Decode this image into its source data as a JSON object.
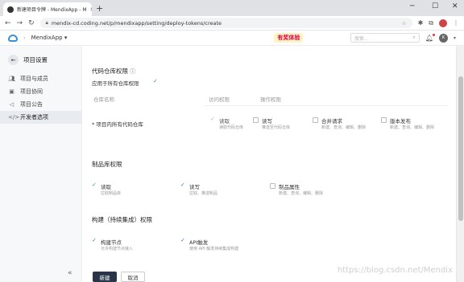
{
  "browser": {
    "tab_title": "新建项目令牌 - MendixApp - M",
    "url": "mendix-cd.coding.net/p/mendixapp/setting/deploy-tokens/create"
  },
  "header": {
    "project": "MendixApp",
    "promo": "有奖体验",
    "search_placeholder": "搜索...",
    "avatar_initial": "K"
  },
  "sidebar": {
    "back_label": "项目设置",
    "items": [
      {
        "label": "项目与成员",
        "icon": "members-icon",
        "active": false
      },
      {
        "label": "项目协同",
        "icon": "collab-icon",
        "active": false
      },
      {
        "label": "项目公告",
        "icon": "announce-icon",
        "active": false
      },
      {
        "label": "开发者选项",
        "icon": "code-icon",
        "active": true
      }
    ]
  },
  "repo": {
    "title": "代码仓库权限",
    "apply_all": "应用于所有仓库权限",
    "col_name": "仓库名称",
    "col_access": "访问权限",
    "col_ops": "操作权限",
    "row_name": "* 项目内所有代码仓库",
    "perms": [
      {
        "label": "读取",
        "hint": "读取代码仓库",
        "checked": true,
        "disabled": true
      },
      {
        "label": "读写",
        "hint": "推送至代码仓库",
        "checked": false
      },
      {
        "label": "合并请求",
        "hint": "新建、查询、编辑、删除",
        "checked": false
      },
      {
        "label": "版本发布",
        "hint": "新建、查询、编辑、删除",
        "checked": false
      }
    ]
  },
  "artifact": {
    "title": "制品库权限",
    "perms": [
      {
        "label": "读取",
        "hint": "拉取制品库",
        "checked": true
      },
      {
        "label": "读写",
        "hint": "拉取、推送制品",
        "checked": true
      },
      {
        "label": "制品属性",
        "hint": "新建、查询、编辑、删除",
        "checked": false
      }
    ]
  },
  "ci": {
    "title": "构建（持续集成）权限",
    "perms": [
      {
        "label": "构建节点",
        "hint": "允许构建节点接入",
        "checked": true
      },
      {
        "label": "API触发",
        "hint": "使用 API 触发持续集成构建",
        "checked": true
      }
    ]
  },
  "actions": {
    "create": "新建",
    "cancel": "取消"
  },
  "watermark": "https://blog.csdn.net/Mendix"
}
